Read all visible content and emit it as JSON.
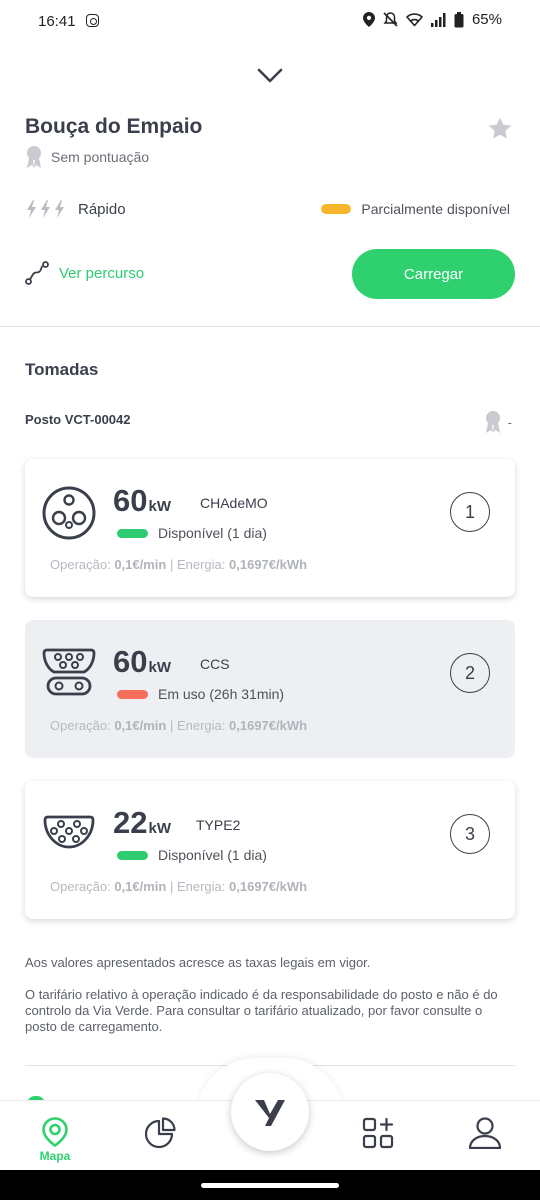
{
  "status_bar": {
    "time": "16:41",
    "battery": "65%"
  },
  "station": {
    "name": "Bouça do Empaio",
    "rating": "Sem pontuação",
    "speed": "Rápido",
    "availability": "Parcialmente disponível",
    "route_link": "Ver percurso",
    "charge_button": "Carregar"
  },
  "sockets_section": {
    "title": "Tomadas",
    "posto_id": "Posto VCT-00042",
    "posto_rating": "-"
  },
  "colors": {
    "accent": "#2fd16e",
    "partial": "#f6b52c",
    "available": "#2ecc71",
    "in_use": "#f56d5b"
  },
  "cards": [
    {
      "power": "60",
      "unit": "kW",
      "type": "CHAdeMO",
      "status": "Disponível (1 dia)",
      "status_color": "#2ecc71",
      "price_op_label": "Operação: ",
      "price_op": "0,1€/min",
      "sep": " | ",
      "price_en_label": "Energia: ",
      "price_en": "0,1697€/kWh",
      "number": "1",
      "plug_icon": "chademo-plug-icon"
    },
    {
      "power": "60",
      "unit": "kW",
      "type": "CCS",
      "status": "Em uso (26h 31min)",
      "status_color": "#f56d5b",
      "price_op_label": "Operação: ",
      "price_op": "0,1€/min",
      "sep": " | ",
      "price_en_label": "Energia: ",
      "price_en": "0,1697€/kWh",
      "number": "2",
      "plug_icon": "ccs-plug-icon"
    },
    {
      "power": "22",
      "unit": "kW",
      "type": "TYPE2",
      "status": "Disponível (1 dia)",
      "status_color": "#2ecc71",
      "price_op_label": "Operação: ",
      "price_op": "0,1€/min",
      "sep": " | ",
      "price_en_label": "Energia: ",
      "price_en": "0,1697€/kWh",
      "number": "3",
      "plug_icon": "type2-plug-icon"
    }
  ],
  "notes": {
    "taxes": "Aos valores apresentados acresce as taxas legais em vigor.",
    "tariff": "O tarifário relativo à operação indicado é da responsabilidade do posto e não é do controlo da Via Verde. Para consultar o tarifário atualizado, por favor consulte o posto de carregamento."
  },
  "bottom_nav": {
    "map_label": "Mapa"
  }
}
